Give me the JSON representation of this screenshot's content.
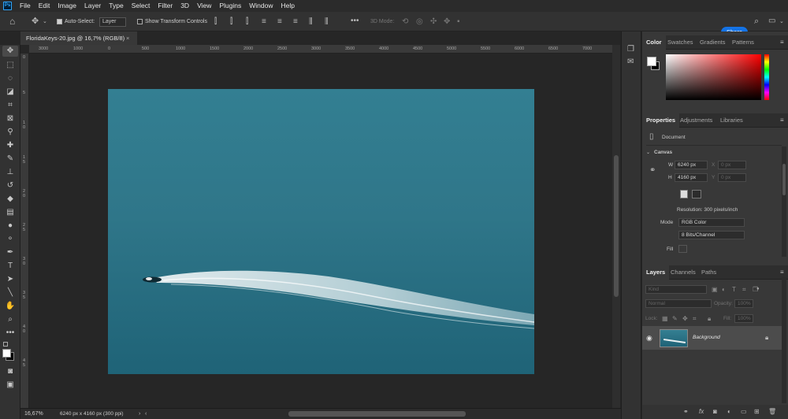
{
  "app": {
    "logo_text": "Ps"
  },
  "menu": [
    "File",
    "Edit",
    "Image",
    "Layer",
    "Type",
    "Select",
    "Filter",
    "3D",
    "View",
    "Plugins",
    "Window",
    "Help"
  ],
  "options": {
    "auto_select_label": "Auto-Select:",
    "auto_select_value": "Layer",
    "transform_label": "Show Transform Controls",
    "mode_3d_label": "3D Mode:",
    "share_label": "Share"
  },
  "document": {
    "tab_title": "FloridaKeys-20.jpg @ 16,7% (RGB/8)",
    "close_glyph": "×"
  },
  "ruler": {
    "h_ticks": [
      "3000",
      "1000",
      "0",
      "500",
      "1000",
      "1500",
      "2000",
      "2500",
      "3000",
      "3500",
      "4000",
      "4500",
      "5000",
      "5500",
      "6000",
      "6500",
      "7000"
    ],
    "v_ticks": [
      "0",
      "5",
      "1",
      "0",
      "1",
      "5",
      "2",
      "0",
      "2",
      "5",
      "3",
      "0",
      "3",
      "5",
      "4",
      "0",
      "4",
      "5"
    ]
  },
  "status": {
    "zoom": "16,67%",
    "info": "6240 px x 4160 px (300 ppi)"
  },
  "color_panel": {
    "tabs": [
      "Color",
      "Swatches",
      "Gradients",
      "Patterns"
    ],
    "fg": "#ffffff",
    "bg": "#000000",
    "hue": "#ff0000"
  },
  "properties": {
    "tabs": [
      "Properties",
      "Adjustments",
      "Libraries"
    ],
    "document_label": "Document",
    "canvas_label": "Canvas",
    "w_label": "W",
    "w_value": "6240 px",
    "h_label": "H",
    "h_value": "4160 px",
    "x_label": "X",
    "x_value": "0 px",
    "y_label": "Y",
    "y_value": "0 px",
    "resolution": "Resolution: 300 pixels/inch",
    "mode_label": "Mode",
    "mode_value": "RGB Color",
    "depth_value": "8 Bits/Channel",
    "fill_label": "Fill"
  },
  "layers": {
    "tabs": [
      "Layers",
      "Channels",
      "Paths"
    ],
    "kind_label": "Kind",
    "blend_mode": "Normal",
    "opacity_label": "Opacity:",
    "opacity_value": "100%",
    "lock_label": "Lock:",
    "fill_label": "Fill:",
    "fill_value": "100%",
    "layer_name": "Background"
  }
}
